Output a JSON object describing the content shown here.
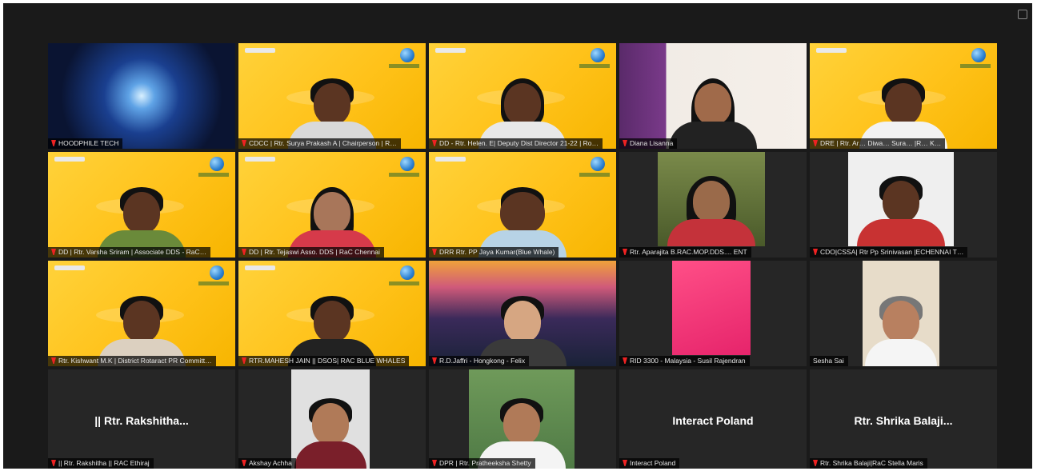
{
  "app": {
    "name": "Zoom gallery view"
  },
  "tiles": [
    {
      "label": "HOODPHILE TECH",
      "type": "abstract"
    },
    {
      "label": "CDCC | Rtr. Surya Prakash A | Chairperson | R…",
      "type": "yellow",
      "shirt": "#d9d9d9"
    },
    {
      "label": "DD - Rtr. Helen. E| Deputy Dist Director 21-22 | Ro…",
      "type": "yellow",
      "shirt": "#e8e8e8"
    },
    {
      "label": "Diana Lisanna",
      "type": "wall",
      "shirt": "#222"
    },
    {
      "label": "DRE | Rtr. Ar… Diwa… Sura… |R… K…",
      "type": "yellow",
      "shirt": "#f2f2f2"
    },
    {
      "label": "DD | Rtr. Varsha Sriram | Associate DDS - RaC…",
      "type": "yellow",
      "shirt": "#6a8a3a"
    },
    {
      "label": "DD | Rtr. Tejaswi Asso. DDS | RaC Chennai",
      "type": "yellow",
      "shirt": "#d63a4a"
    },
    {
      "label": "DRR Rtr. PP Jaya Kumar(Blue Whale)",
      "type": "yellow",
      "shirt": "#b7d3e6"
    },
    {
      "label": "Rtr. Aparajita B.RAC.MOP.DDS.... ENT",
      "type": "leaf",
      "shirt": "#c4323a"
    },
    {
      "label": "CDO|CSSA| Rtr Pp Srinivasan |ECHENNAI T…",
      "type": "white",
      "shirt": "#c83232"
    },
    {
      "label": "Rtr. Kishwant M.K | District Rotaract PR Committ…",
      "type": "yellow",
      "shirt": "#dcd0c0"
    },
    {
      "label": "RTR.MAHESH JAIN || DSOS| RAC BLUE WHALES",
      "type": "yellow",
      "shirt": "#222"
    },
    {
      "label": "R.D.Jaffri - Hongkong - Felix",
      "type": "city",
      "shirt": "#3a3a3a"
    },
    {
      "label": "RID 3300 - Malaysia - Susil Rajendran",
      "type": "pink",
      "shirt": "#333"
    },
    {
      "label": "Sesha Sai",
      "type": "light",
      "shirt": "#f5f5f5"
    },
    {
      "label": "|| Rtr. Rakshitha || RAC Ethiraj",
      "type": "name",
      "bigname": "|| Rtr. Rakshitha..."
    },
    {
      "label": "Akshay Achha",
      "type": "whitecam",
      "shirt": "#7a1f2a"
    },
    {
      "label": "DPR | Rtr. Pratheeksha Shetty",
      "type": "green",
      "shirt": "#f4f4f4"
    },
    {
      "label": "Interact Poland",
      "type": "name",
      "bigname": "Interact Poland"
    },
    {
      "label": "Rtr. Shrika Balaji|RaC Stella Maris",
      "type": "name",
      "bigname": "Rtr. Shrika Balaji..."
    }
  ],
  "colors": {
    "accent": "#ffc21a",
    "active_border": "#cfd86a",
    "mic_muted": "#e22222"
  }
}
